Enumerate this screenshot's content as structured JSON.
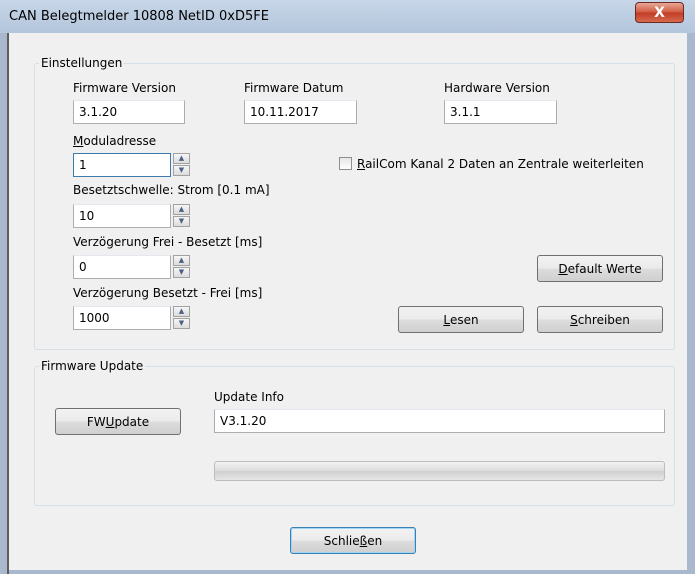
{
  "window": {
    "title": "CAN  Belegtmelder 10808 NetID 0xD5FE",
    "close_label": "X"
  },
  "settings": {
    "group_label": "Einstellungen",
    "firmware_version": {
      "label": "Firmware Version",
      "value": "3.1.20"
    },
    "firmware_date": {
      "label": "Firmware Datum",
      "value": "10.11.2017"
    },
    "hardware_version": {
      "label": "Hardware Version",
      "value": "3.1.1"
    },
    "module_address": {
      "label_accel": "M",
      "label_rest": "oduladresse",
      "value": "1"
    },
    "occupancy_threshold": {
      "label": "Besetztschwelle: Strom [0.1 mA]",
      "value": "10"
    },
    "delay_free_occupied": {
      "label": "Verzögerung Frei - Besetzt [ms]",
      "value": "0"
    },
    "delay_occupied_free": {
      "label": "Verzögerung Besetzt - Frei [ms]",
      "value": "1000"
    },
    "railcom": {
      "label_accel": "R",
      "label_rest": "ailCom Kanal 2 Daten an Zentrale weiterleiten",
      "checked": false
    },
    "default_button": {
      "accel": "D",
      "rest": "efault Werte"
    },
    "read_button": {
      "accel": "L",
      "rest": "esen"
    },
    "write_button": {
      "accel": "S",
      "rest": "chreiben"
    }
  },
  "firmware_update": {
    "group_label": "Firmware Update",
    "button": {
      "prefix": "FW ",
      "accel": "U",
      "rest": "pdate"
    },
    "info_label": "Update Info",
    "info_value": "V3.1.20",
    "progress": 0
  },
  "footer": {
    "close_prefix": "Schlie",
    "close_accel": "ß",
    "close_rest": "en"
  }
}
